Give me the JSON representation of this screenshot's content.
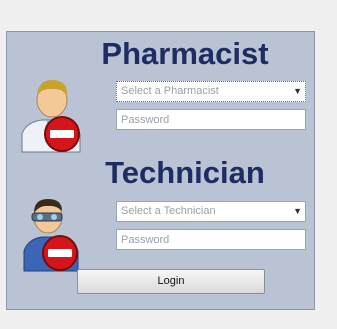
{
  "pharmacist": {
    "heading": "Pharmacist",
    "select_placeholder": "Select a Pharmacist",
    "password_placeholder": "Password",
    "avatar_icon": "pharmacist-denied-icon"
  },
  "technician": {
    "heading": "Technician",
    "select_placeholder": "Select a Technician",
    "password_placeholder": "Password",
    "avatar_icon": "technician-denied-icon"
  },
  "login_button": {
    "label": "Login"
  },
  "colors": {
    "panel": "#b9c3d3",
    "heading": "#1e2c63",
    "deny_red": "#d4161b"
  }
}
